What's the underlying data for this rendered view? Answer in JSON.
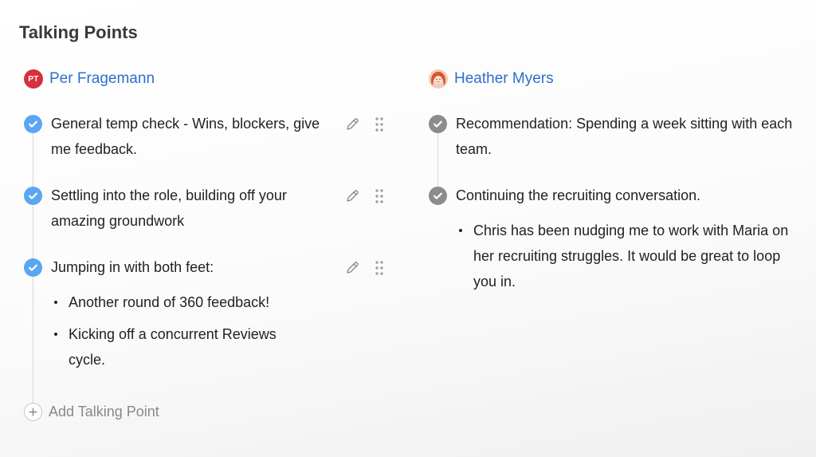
{
  "page": {
    "title": "Talking Points"
  },
  "columns": [
    {
      "author": {
        "name": "Per Fragemann",
        "initials": "PT",
        "avatar_color": "#d6303c"
      },
      "points": [
        {
          "text": "General temp check - Wins, blockers, give me feedback.",
          "status": "checked"
        },
        {
          "text": "Settling into the role, building off your amazing groundwork",
          "status": "checked"
        },
        {
          "text": "Jumping in with both feet:",
          "status": "checked",
          "sub": [
            "Another round of 360 feedback!",
            "Kicking off a concurrent Reviews cycle."
          ]
        }
      ]
    },
    {
      "author": {
        "name": "Heather Myers"
      },
      "points": [
        {
          "text": "Recommendation: Spending a week sitting with each team.",
          "status": "checked"
        },
        {
          "text": "Continuing the recruiting conversation.",
          "status": "checked",
          "sub": [
            "Chris has been nudging me to work with Maria on her recruiting struggles. It would be great to loop you in."
          ]
        }
      ]
    }
  ],
  "add_point": {
    "label": "Add Talking Point"
  },
  "colors": {
    "accent": "#2c6fc9",
    "check_blue": "#5aa6f0",
    "check_grey": "#8c8c8c"
  },
  "icons": {
    "check": "check-icon",
    "edit": "pencil-icon",
    "drag": "drag-handle-icon",
    "add": "plus-icon"
  }
}
